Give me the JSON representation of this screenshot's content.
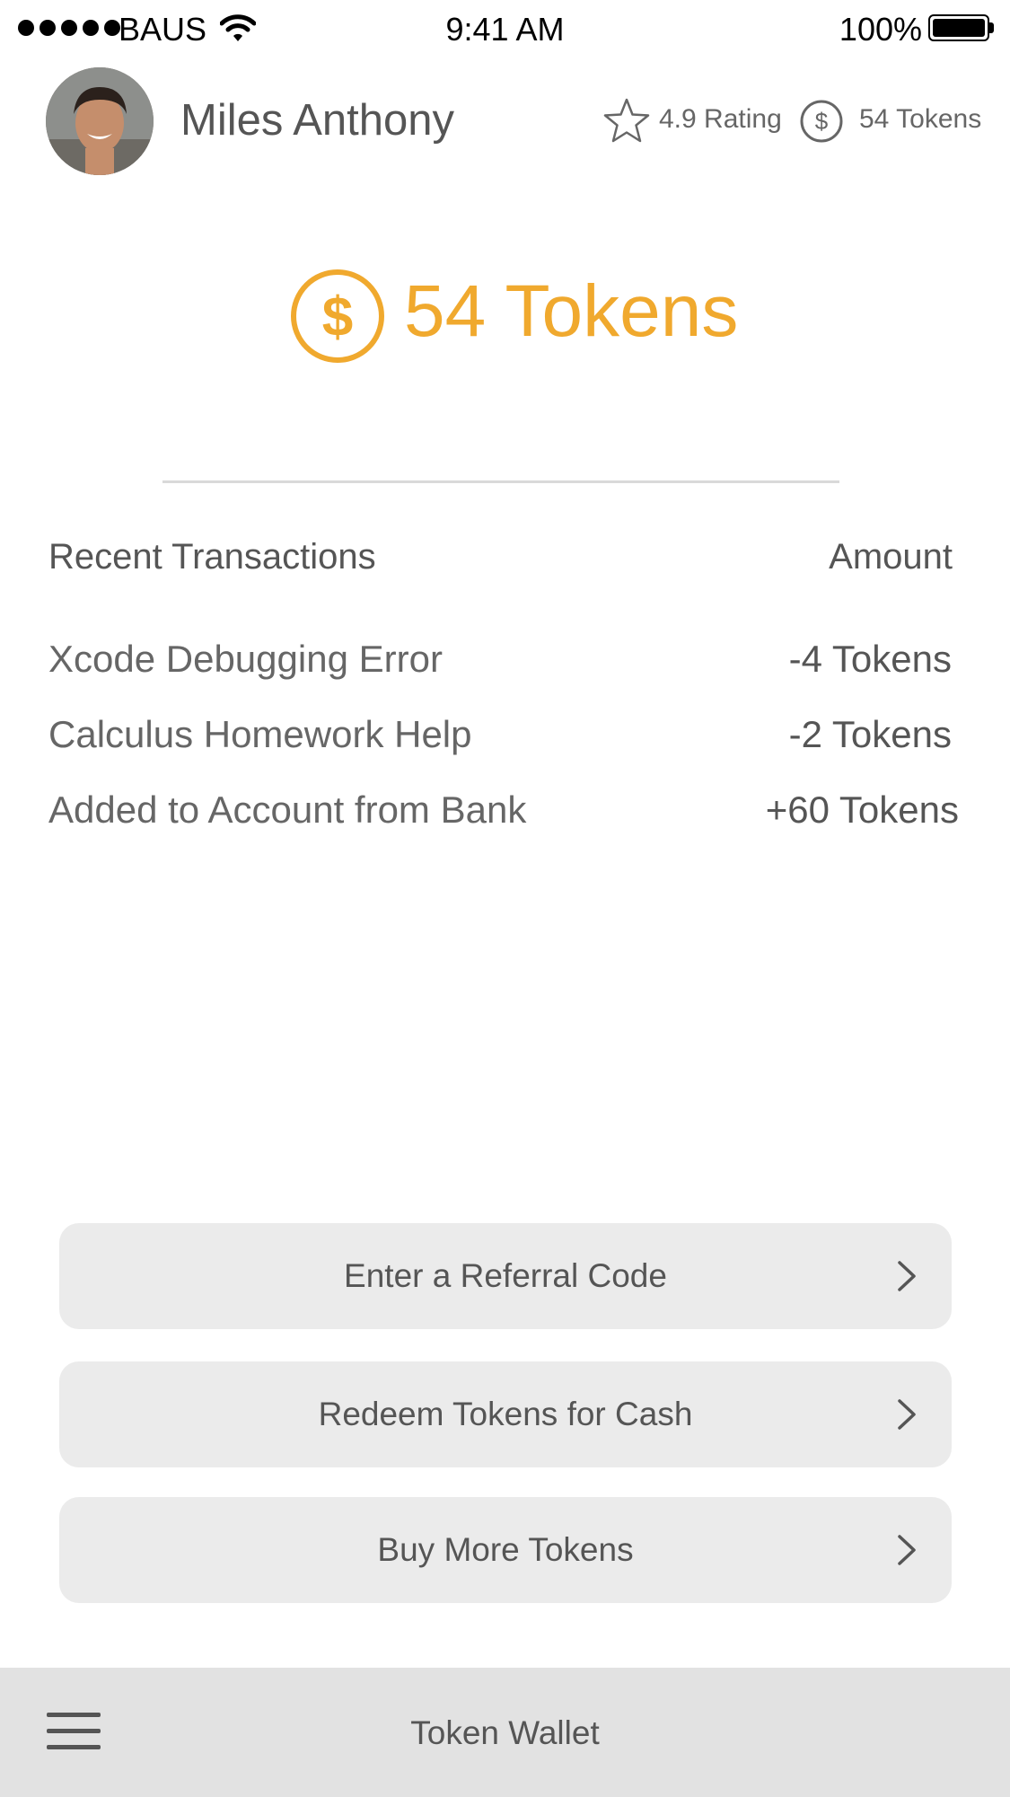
{
  "status_bar": {
    "carrier": "BAUS",
    "time": "9:41 AM",
    "battery": "100%"
  },
  "profile": {
    "name": "Miles Anthony",
    "rating": "4.9 Rating",
    "tokens": "54 Tokens"
  },
  "balance": {
    "tokens": "54 Tokens"
  },
  "transactions": {
    "header_label": "Recent Transactions",
    "header_amount": "Amount",
    "items": [
      {
        "description": "Xcode Debugging Error",
        "amount": "-4 Tokens"
      },
      {
        "description": "Calculus Homework Help",
        "amount": "-2 Tokens"
      },
      {
        "description": "Added to Account from Bank",
        "amount": "+60 Tokens"
      }
    ]
  },
  "actions": [
    {
      "label": "Enter a Referral Code"
    },
    {
      "label": "Redeem Tokens for Cash"
    },
    {
      "label": "Buy More Tokens"
    }
  ],
  "bottom_bar": {
    "title": "Token Wallet"
  },
  "colors": {
    "accent": "#f0a92e",
    "text": "#555555",
    "button_bg": "#ebebeb",
    "bottom_bar_bg": "#e2e2e2"
  },
  "icons": {
    "rating": "star-icon",
    "token": "dollar-coin-icon",
    "menu": "hamburger-menu-icon",
    "chevron": "chevron-right-icon"
  }
}
